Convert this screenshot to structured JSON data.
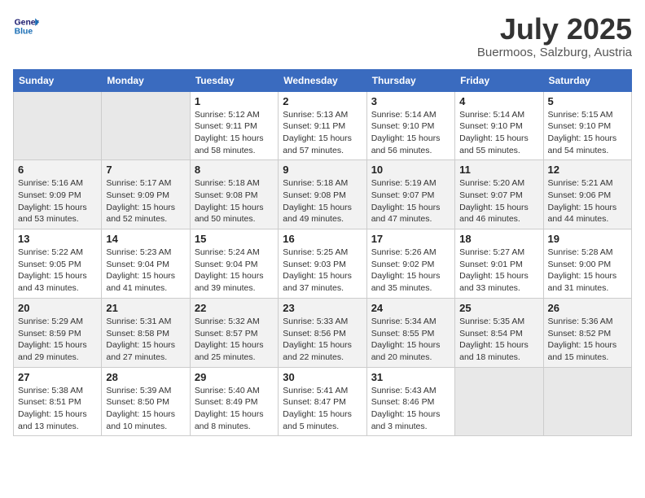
{
  "header": {
    "logo_line1": "General",
    "logo_line2": "Blue",
    "month_year": "July 2025",
    "location": "Buermoos, Salzburg, Austria"
  },
  "days_of_week": [
    "Sunday",
    "Monday",
    "Tuesday",
    "Wednesday",
    "Thursday",
    "Friday",
    "Saturday"
  ],
  "weeks": [
    [
      {
        "num": "",
        "sunrise": "",
        "sunset": "",
        "daylight": ""
      },
      {
        "num": "",
        "sunrise": "",
        "sunset": "",
        "daylight": ""
      },
      {
        "num": "1",
        "sunrise": "Sunrise: 5:12 AM",
        "sunset": "Sunset: 9:11 PM",
        "daylight": "Daylight: 15 hours and 58 minutes."
      },
      {
        "num": "2",
        "sunrise": "Sunrise: 5:13 AM",
        "sunset": "Sunset: 9:11 PM",
        "daylight": "Daylight: 15 hours and 57 minutes."
      },
      {
        "num": "3",
        "sunrise": "Sunrise: 5:14 AM",
        "sunset": "Sunset: 9:10 PM",
        "daylight": "Daylight: 15 hours and 56 minutes."
      },
      {
        "num": "4",
        "sunrise": "Sunrise: 5:14 AM",
        "sunset": "Sunset: 9:10 PM",
        "daylight": "Daylight: 15 hours and 55 minutes."
      },
      {
        "num": "5",
        "sunrise": "Sunrise: 5:15 AM",
        "sunset": "Sunset: 9:10 PM",
        "daylight": "Daylight: 15 hours and 54 minutes."
      }
    ],
    [
      {
        "num": "6",
        "sunrise": "Sunrise: 5:16 AM",
        "sunset": "Sunset: 9:09 PM",
        "daylight": "Daylight: 15 hours and 53 minutes."
      },
      {
        "num": "7",
        "sunrise": "Sunrise: 5:17 AM",
        "sunset": "Sunset: 9:09 PM",
        "daylight": "Daylight: 15 hours and 52 minutes."
      },
      {
        "num": "8",
        "sunrise": "Sunrise: 5:18 AM",
        "sunset": "Sunset: 9:08 PM",
        "daylight": "Daylight: 15 hours and 50 minutes."
      },
      {
        "num": "9",
        "sunrise": "Sunrise: 5:18 AM",
        "sunset": "Sunset: 9:08 PM",
        "daylight": "Daylight: 15 hours and 49 minutes."
      },
      {
        "num": "10",
        "sunrise": "Sunrise: 5:19 AM",
        "sunset": "Sunset: 9:07 PM",
        "daylight": "Daylight: 15 hours and 47 minutes."
      },
      {
        "num": "11",
        "sunrise": "Sunrise: 5:20 AM",
        "sunset": "Sunset: 9:07 PM",
        "daylight": "Daylight: 15 hours and 46 minutes."
      },
      {
        "num": "12",
        "sunrise": "Sunrise: 5:21 AM",
        "sunset": "Sunset: 9:06 PM",
        "daylight": "Daylight: 15 hours and 44 minutes."
      }
    ],
    [
      {
        "num": "13",
        "sunrise": "Sunrise: 5:22 AM",
        "sunset": "Sunset: 9:05 PM",
        "daylight": "Daylight: 15 hours and 43 minutes."
      },
      {
        "num": "14",
        "sunrise": "Sunrise: 5:23 AM",
        "sunset": "Sunset: 9:04 PM",
        "daylight": "Daylight: 15 hours and 41 minutes."
      },
      {
        "num": "15",
        "sunrise": "Sunrise: 5:24 AM",
        "sunset": "Sunset: 9:04 PM",
        "daylight": "Daylight: 15 hours and 39 minutes."
      },
      {
        "num": "16",
        "sunrise": "Sunrise: 5:25 AM",
        "sunset": "Sunset: 9:03 PM",
        "daylight": "Daylight: 15 hours and 37 minutes."
      },
      {
        "num": "17",
        "sunrise": "Sunrise: 5:26 AM",
        "sunset": "Sunset: 9:02 PM",
        "daylight": "Daylight: 15 hours and 35 minutes."
      },
      {
        "num": "18",
        "sunrise": "Sunrise: 5:27 AM",
        "sunset": "Sunset: 9:01 PM",
        "daylight": "Daylight: 15 hours and 33 minutes."
      },
      {
        "num": "19",
        "sunrise": "Sunrise: 5:28 AM",
        "sunset": "Sunset: 9:00 PM",
        "daylight": "Daylight: 15 hours and 31 minutes."
      }
    ],
    [
      {
        "num": "20",
        "sunrise": "Sunrise: 5:29 AM",
        "sunset": "Sunset: 8:59 PM",
        "daylight": "Daylight: 15 hours and 29 minutes."
      },
      {
        "num": "21",
        "sunrise": "Sunrise: 5:31 AM",
        "sunset": "Sunset: 8:58 PM",
        "daylight": "Daylight: 15 hours and 27 minutes."
      },
      {
        "num": "22",
        "sunrise": "Sunrise: 5:32 AM",
        "sunset": "Sunset: 8:57 PM",
        "daylight": "Daylight: 15 hours and 25 minutes."
      },
      {
        "num": "23",
        "sunrise": "Sunrise: 5:33 AM",
        "sunset": "Sunset: 8:56 PM",
        "daylight": "Daylight: 15 hours and 22 minutes."
      },
      {
        "num": "24",
        "sunrise": "Sunrise: 5:34 AM",
        "sunset": "Sunset: 8:55 PM",
        "daylight": "Daylight: 15 hours and 20 minutes."
      },
      {
        "num": "25",
        "sunrise": "Sunrise: 5:35 AM",
        "sunset": "Sunset: 8:54 PM",
        "daylight": "Daylight: 15 hours and 18 minutes."
      },
      {
        "num": "26",
        "sunrise": "Sunrise: 5:36 AM",
        "sunset": "Sunset: 8:52 PM",
        "daylight": "Daylight: 15 hours and 15 minutes."
      }
    ],
    [
      {
        "num": "27",
        "sunrise": "Sunrise: 5:38 AM",
        "sunset": "Sunset: 8:51 PM",
        "daylight": "Daylight: 15 hours and 13 minutes."
      },
      {
        "num": "28",
        "sunrise": "Sunrise: 5:39 AM",
        "sunset": "Sunset: 8:50 PM",
        "daylight": "Daylight: 15 hours and 10 minutes."
      },
      {
        "num": "29",
        "sunrise": "Sunrise: 5:40 AM",
        "sunset": "Sunset: 8:49 PM",
        "daylight": "Daylight: 15 hours and 8 minutes."
      },
      {
        "num": "30",
        "sunrise": "Sunrise: 5:41 AM",
        "sunset": "Sunset: 8:47 PM",
        "daylight": "Daylight: 15 hours and 5 minutes."
      },
      {
        "num": "31",
        "sunrise": "Sunrise: 5:43 AM",
        "sunset": "Sunset: 8:46 PM",
        "daylight": "Daylight: 15 hours and 3 minutes."
      },
      {
        "num": "",
        "sunrise": "",
        "sunset": "",
        "daylight": ""
      },
      {
        "num": "",
        "sunrise": "",
        "sunset": "",
        "daylight": ""
      }
    ]
  ]
}
